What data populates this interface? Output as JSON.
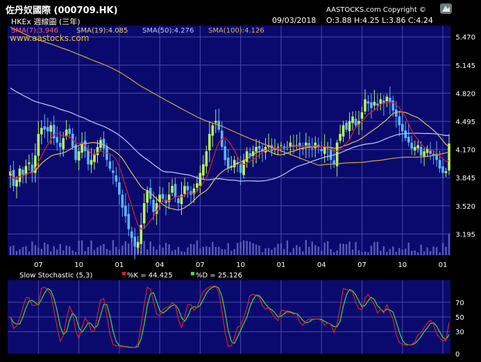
{
  "header": {
    "title": "佐丹奴國際 (000709.HK)",
    "subtitle": "HKEx  週線圖 (三年)",
    "brand": "AASTOCKS.com Copyright ©",
    "date": "09/03/2018",
    "ohlc": "O:3.88  H:4.25  L:3.86  C:4.24",
    "watermark": "www.aastocks.com",
    "logo_icon": "aastocks-logo-icon"
  },
  "legend": {
    "sma7": "SMA(7):3.946",
    "sma19": "SMA(19):4.085",
    "sma50": "SMA(50):4.276",
    "sma100": "SMA(100):4.126"
  },
  "stochastic": {
    "title": "Slow Stochastic (5,3)",
    "k_label": "%K = 44.425",
    "d_label": "%D = 25.126",
    "y_ticks": [
      "70",
      "50",
      "30",
      "0"
    ]
  },
  "colors": {
    "panel_bg": "#0a0a6e",
    "grid": "#4a4aa8",
    "candle_up": "#b8f55a",
    "candle_down": "#5ab5ff",
    "sma7": "#e02020",
    "sma19": "#e6c050",
    "sma50": "#c8c8ff",
    "sma100": "#d8a830",
    "volume": "#5a5ab0",
    "stoch_k": "#e02020",
    "stoch_d": "#40e040",
    "text": "#ffffff",
    "legend_red": "#ff6060",
    "legend_yellow": "#f0d060",
    "legend_lilac": "#c8c8ff",
    "legend_orange": "#e0b040"
  },
  "chart_data": [
    {
      "type": "candlestick",
      "title": "佐丹奴國際 (000709.HK)",
      "ylim": [
        2.95,
        5.6
      ],
      "y_ticks": [
        5.47,
        5.145,
        4.82,
        4.495,
        4.17,
        3.845,
        3.52,
        3.195
      ],
      "y_tick_labels": [
        "5.470",
        "5.145",
        "4.820",
        "4.495",
        "4.170",
        "3.845",
        "3.520",
        "3.195"
      ],
      "x_tick_labels": [
        "07",
        "10",
        "01",
        "04",
        "07",
        "10",
        "01",
        "04",
        "07",
        "10",
        "01"
      ],
      "x_tick_index": [
        9,
        22,
        35,
        48,
        61,
        74,
        87,
        100,
        113,
        126,
        139
      ],
      "close": [
        3.92,
        3.75,
        3.82,
        3.95,
        3.88,
        3.98,
        4.02,
        3.9,
        4.1,
        4.35,
        4.42,
        4.4,
        4.38,
        4.45,
        4.3,
        4.25,
        4.2,
        4.3,
        4.4,
        4.35,
        4.2,
        4.05,
        4.15,
        4.25,
        4.15,
        4.0,
        4.05,
        4.12,
        4.2,
        4.28,
        4.18,
        4.05,
        3.95,
        3.9,
        3.8,
        3.65,
        3.5,
        3.4,
        3.25,
        3.15,
        3.05,
        3.1,
        3.3,
        3.55,
        3.7,
        3.6,
        3.45,
        3.55,
        3.65,
        3.6,
        3.55,
        3.65,
        3.75,
        3.62,
        3.55,
        3.65,
        3.75,
        3.7,
        3.65,
        3.72,
        3.78,
        3.9,
        4.0,
        4.15,
        4.35,
        4.45,
        4.5,
        4.4,
        4.2,
        4.05,
        3.95,
        3.98,
        4.05,
        4.0,
        3.9,
        4.05,
        4.15,
        4.1,
        4.15,
        4.2,
        4.18,
        4.15,
        4.2,
        4.22,
        4.15,
        4.18,
        4.2,
        4.22,
        4.18,
        4.2,
        4.25,
        4.2,
        4.22,
        4.2,
        4.18,
        4.25,
        4.2,
        4.18,
        4.25,
        4.2,
        4.15,
        4.2,
        4.2,
        4.05,
        4.0,
        4.25,
        4.35,
        4.45,
        4.4,
        4.5,
        4.55,
        4.45,
        4.5,
        4.6,
        4.75,
        4.7,
        4.65,
        4.72,
        4.68,
        4.75,
        4.7,
        4.78,
        4.72,
        4.62,
        4.55,
        4.45,
        4.38,
        4.3,
        4.25,
        4.18,
        4.2,
        4.22,
        4.1,
        4.15,
        4.18,
        4.12,
        4.1,
        4.05,
        3.95,
        3.9,
        3.92,
        4.24
      ],
      "series": [
        {
          "name": "SMA(7):3.946",
          "last": 3.946
        },
        {
          "name": "SMA(19):4.085",
          "last": 4.085
        },
        {
          "name": "SMA(50):4.276",
          "last": 4.276
        },
        {
          "name": "SMA(100):4.126",
          "last": 4.126
        }
      ]
    },
    {
      "type": "line",
      "title": "Slow Stochastic (5,3)",
      "ylim": [
        0,
        100
      ],
      "y_ticks": [
        70,
        50,
        30,
        0
      ],
      "series": [
        {
          "name": "%K = 44.425",
          "last": 44.425
        },
        {
          "name": "%D = 25.126",
          "last": 25.126
        }
      ]
    }
  ]
}
